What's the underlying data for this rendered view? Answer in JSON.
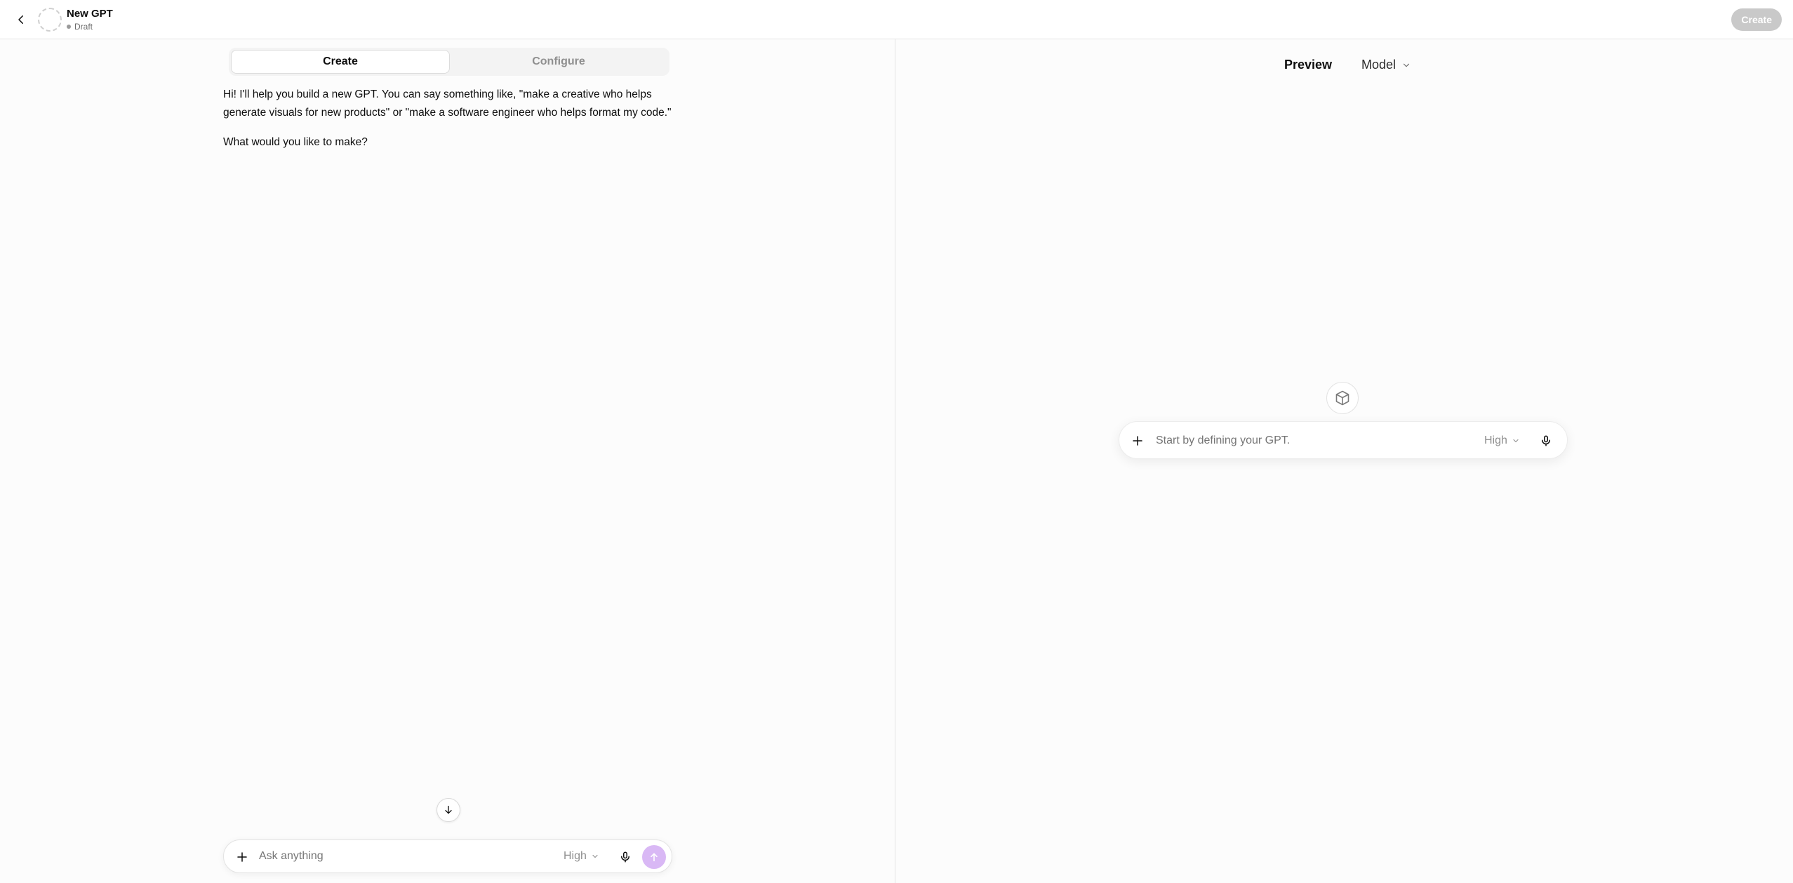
{
  "header": {
    "gpt_name": "New GPT",
    "status": "Draft",
    "create_button": "Create"
  },
  "builder": {
    "tabs": [
      {
        "label": "Create",
        "active": true
      },
      {
        "label": "Configure",
        "active": false
      }
    ],
    "message": {
      "paragraph_1": "Hi! I'll help you build a new GPT. You can say something like, \"make a creative who helps generate visuals for new products\" or \"make a software engineer who helps format my code.\"",
      "paragraph_2": "What would you like to make?"
    },
    "composer": {
      "placeholder": "Ask anything",
      "effort": "High"
    }
  },
  "preview": {
    "label": "Preview",
    "model_label": "Model",
    "composer": {
      "placeholder": "Start by defining your GPT.",
      "effort": "High"
    }
  },
  "icons": {
    "back": "chevron-left-icon",
    "plus": "plus-icon",
    "mic": "microphone-icon",
    "send": "arrow-up-icon",
    "scroll": "arrow-down-icon",
    "cube": "cube-icon",
    "chevron": "chevron-down-icon"
  },
  "colors": {
    "send_button": "#d9b8f5",
    "create_button_disabled": "#c9c9c9"
  }
}
